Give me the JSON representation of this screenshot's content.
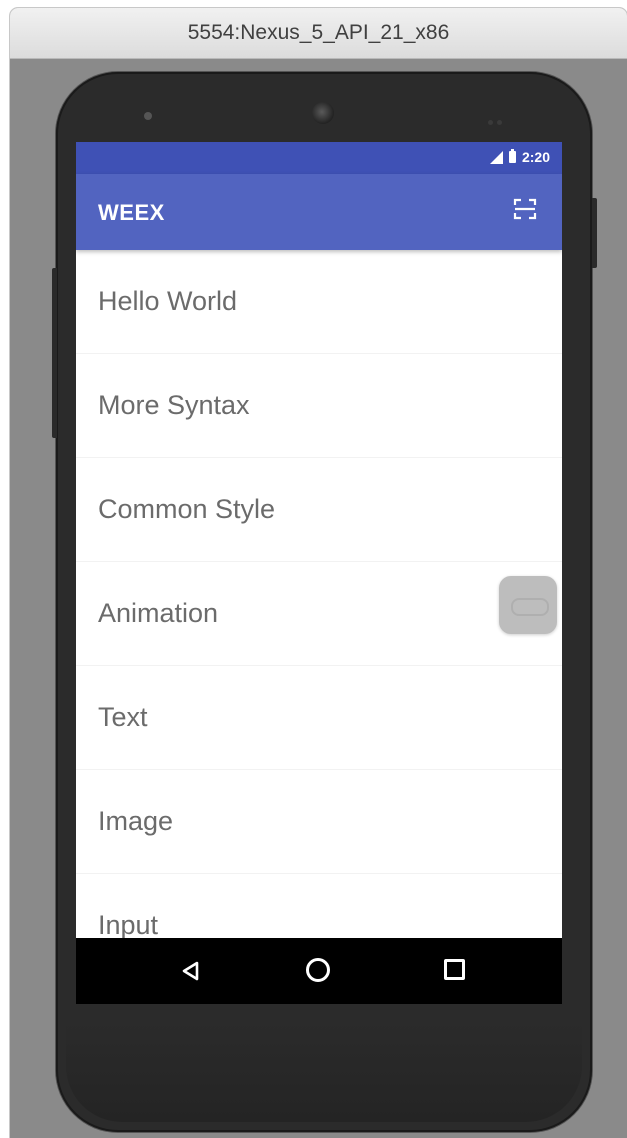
{
  "window": {
    "title": "5554:Nexus_5_API_21_x86"
  },
  "status_bar": {
    "time": "2:20",
    "icons": [
      "signal-icon",
      "battery-icon"
    ]
  },
  "app_bar": {
    "title": "WEEX",
    "action_icon": "scan-icon"
  },
  "list": {
    "items": [
      {
        "label": "Hello World"
      },
      {
        "label": "More Syntax"
      },
      {
        "label": "Common Style"
      },
      {
        "label": "Animation"
      },
      {
        "label": "Text"
      },
      {
        "label": "Image"
      },
      {
        "label": "Input"
      }
    ]
  },
  "floating_button": {
    "icon": "assistive-touch-icon"
  },
  "nav_bar": {
    "icons": [
      "back-icon",
      "home-icon",
      "recent-apps-icon"
    ]
  },
  "colors": {
    "status_bar": "#3f51b5",
    "app_bar": "#5264c0",
    "list_text": "#6b6b6b",
    "nav_bar": "#000000"
  }
}
